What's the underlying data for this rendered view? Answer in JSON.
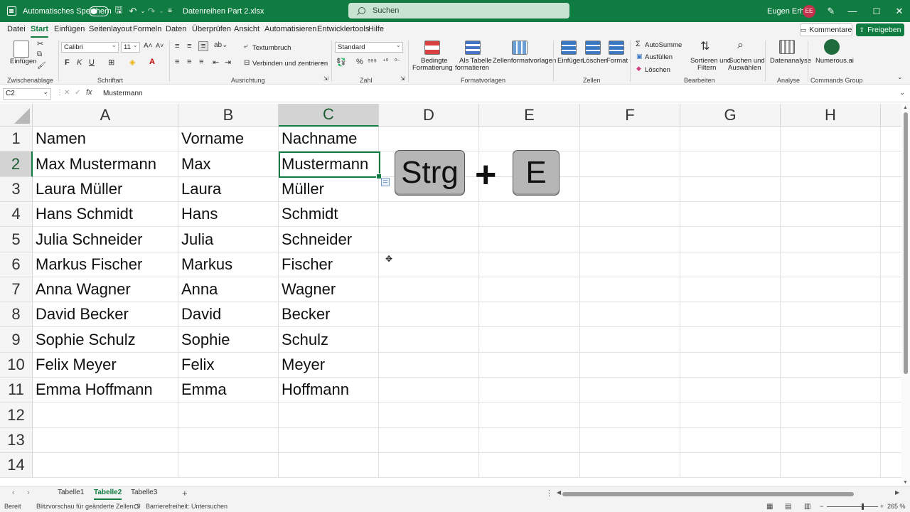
{
  "titlebar": {
    "autosave_label": "Automatisches Speichern",
    "doc_title": "Datenreihen Part 2.xlsx",
    "search_placeholder": "Suchen",
    "user_name": "Eugen Erhart",
    "user_initials": "EE"
  },
  "menu": {
    "items": [
      "Datei",
      "Start",
      "Einfügen",
      "Seitenlayout",
      "Formeln",
      "Daten",
      "Überprüfen",
      "Ansicht",
      "Automatisieren",
      "Entwicklertools",
      "Hilfe"
    ],
    "active": "Start",
    "comments_label": "Kommentare",
    "share_label": "Freigeben"
  },
  "ribbon": {
    "paste_label": "Einfügen",
    "font_name": "Calibri",
    "font_size": "11",
    "bold": "F",
    "italic": "K",
    "underline": "U",
    "wrap_text": "Textumbruch",
    "merge_center": "Verbinden und zentrieren",
    "number_format": "Standard",
    "percent": "%",
    "conditional_line1": "Bedingte",
    "conditional_line2": "Formatierung",
    "as_table_line1": "Als Tabelle",
    "as_table_line2": "formatieren",
    "cell_styles": "Zellenformatvorlagen",
    "insert_cells": "Einfügen",
    "delete_cells": "Löschen",
    "format_cells": "Format",
    "autosum": "AutoSumme",
    "fill": "Ausfüllen",
    "clear": "Löschen",
    "sort_line1": "Sortieren und",
    "sort_line2": "Filtern",
    "find_line1": "Suchen und",
    "find_line2": "Auswählen",
    "data_analysis": "Datenanalyse",
    "numerous": "Numerous.ai",
    "groups": {
      "clipboard": "Zwischenablage",
      "font": "Schriftart",
      "alignment": "Ausrichtung",
      "number": "Zahl",
      "styles": "Formatvorlagen",
      "cells": "Zellen",
      "editing": "Bearbeiten",
      "analysis": "Analyse",
      "commands": "Commands Group"
    }
  },
  "formula_bar": {
    "name_box": "C2",
    "fx": "fx",
    "content": "Mustermann"
  },
  "sheet": {
    "columns": [
      "A",
      "B",
      "C",
      "D",
      "E",
      "F",
      "G",
      "H"
    ],
    "selected_column": "C",
    "rows": [
      "1",
      "2",
      "3",
      "4",
      "5",
      "6",
      "7",
      "8",
      "9",
      "10",
      "11",
      "12",
      "13",
      "14"
    ],
    "selected_row": "2",
    "data": [
      [
        "Namen",
        "Vorname",
        "Nachname"
      ],
      [
        "Max Mustermann",
        "Max",
        "Mustermann"
      ],
      [
        "Laura Müller",
        "Laura",
        "Müller"
      ],
      [
        "Hans Schmidt",
        "Hans",
        "Schmidt"
      ],
      [
        "Julia Schneider",
        "Julia",
        "Schneider"
      ],
      [
        "Markus Fischer",
        "Markus",
        "Fischer"
      ],
      [
        "Anna Wagner",
        "Anna",
        "Wagner"
      ],
      [
        "David Becker",
        "David",
        "Becker"
      ],
      [
        "Sophie Schulz",
        "Sophie",
        "Schulz"
      ],
      [
        "Felix Meyer",
        "Felix",
        "Meyer"
      ],
      [
        "Emma Hoffmann",
        "Emma",
        "Hoffmann"
      ]
    ]
  },
  "shortcut": {
    "key1": "Strg",
    "plus": "+",
    "key2": "E"
  },
  "tabs": {
    "sheets": [
      "Tabelle1",
      "Tabelle2",
      "Tabelle3"
    ],
    "active": "Tabelle2",
    "add": "+"
  },
  "status": {
    "ready": "Bereit",
    "flash_fill": "Blitzvorschau für geänderte Zellen: 9",
    "accessibility": "Barrierefreiheit: Untersuchen",
    "zoom": "265 %"
  },
  "colors": {
    "excel_green": "#107c41",
    "key_fill": "#b6b6b6"
  }
}
